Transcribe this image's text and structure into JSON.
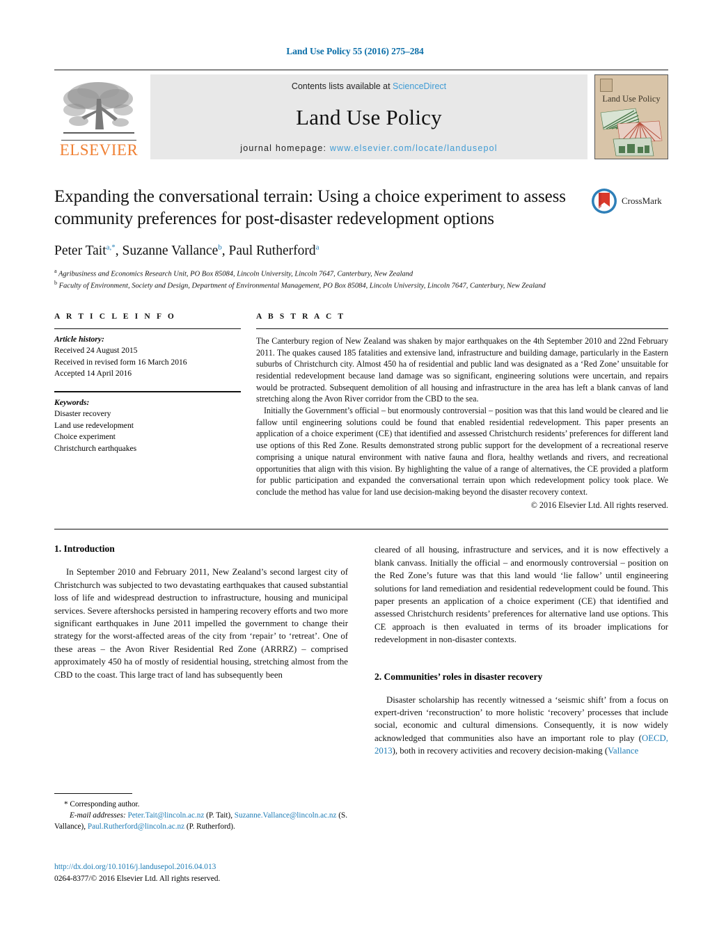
{
  "running_head": "Land Use Policy 55 (2016) 275–284",
  "masthead": {
    "contents_prefix": "Contents lists available at ",
    "sciencedirect": "ScienceDirect",
    "journal_name": "Land Use Policy",
    "homepage_prefix": "journal homepage: ",
    "homepage_url": "www.elsevier.com/locate/landusepol",
    "publisher": "ELSEVIER",
    "cover_title": "Land Use Policy",
    "logo_icon": "elsevier-tree-icon",
    "accent_orange": "#f08033",
    "link_blue": "#3f9bd4"
  },
  "article": {
    "title": "Expanding the conversational terrain: Using a choice experiment to assess community preferences for post-disaster redevelopment options",
    "crossmark_label": "CrossMark",
    "authors_html": "Peter Tait<sup>a,</sup><sup>*</sup>, Suzanne Vallance<sup>b</sup>, Paul Rutherford<sup>a</sup>",
    "affiliation_a": "Agribusiness and Economics Research Unit, PO Box 85084, Lincoln University, Lincoln 7647, Canterbury, New Zealand",
    "affiliation_b": "Faculty of Environment, Society and Design, Department of Environmental Management, PO Box 85084, Lincoln University, Lincoln 7647, Canterbury, New Zealand"
  },
  "article_info": {
    "heading": "A R T I C L E   I N F O",
    "history_label": "Article history:",
    "history": [
      "Received 24 August 2015",
      "Received in revised form 16 March 2016",
      "Accepted 14 April 2016"
    ],
    "keywords_label": "Keywords:",
    "keywords": [
      "Disaster recovery",
      "Land use redevelopment",
      "Choice experiment",
      "Christchurch earthquakes"
    ]
  },
  "abstract": {
    "heading": "A B S T R A C T",
    "paragraph_1": "The Canterbury region of New Zealand was shaken by major earthquakes on the 4th September 2010 and 22nd February 2011. The quakes caused 185 fatalities and extensive land, infrastructure and building damage, particularly in the Eastern suburbs of Christchurch city. Almost 450 ha of residential and public land was designated as a ‘Red Zone’ unsuitable for residential redevelopment because land damage was so significant, engineering solutions were uncertain, and repairs would be protracted. Subsequent demolition of all housing and infrastructure in the area has left a blank canvas of land stretching along the Avon River corridor from the CBD to the sea.",
    "paragraph_2": "Initially the Government’s official – but enormously controversial – position was that this land would be cleared and lie fallow until engineering solutions could be found that enabled residential redevelopment. This paper presents an application of a choice experiment (CE) that identified and assessed Christchurch residents’ preferences for different land use options of this Red Zone. Results demonstrated strong public support for the development of a recreational reserve comprising a unique natural environment with native fauna and flora, healthy wetlands and rivers, and recreational opportunities that align with this vision. By highlighting the value of a range of alternatives, the CE provided a platform for public participation and expanded the conversational terrain upon which redevelopment policy took place. We conclude the method has value for land use decision-making beyond the disaster recovery context.",
    "copyright": "© 2016 Elsevier Ltd. All rights reserved."
  },
  "body": {
    "left": {
      "section_1_heading": "1.  Introduction",
      "paragraph_1": "In September 2010 and February 2011, New Zealand’s second largest city of Christchurch was subjected to two devastating earthquakes that caused substantial loss of life and widespread destruction to infrastructure, housing and municipal services. Severe aftershocks persisted in hampering recovery efforts and two more significant earthquakes in June 2011 impelled the government to change their strategy for the worst-affected areas of the city from ‘repair’ to ‘retreat’. One of these areas – the Avon River Residential Red Zone (ARRRZ) – comprised approximately 450 ha of mostly of residential housing, stretching almost from the CBD to the coast. This large tract of land has subsequently been"
    },
    "right": {
      "paragraph_1": "cleared of all housing, infrastructure and services, and it is now effectively a blank canvass. Initially the official – and enormously controversial – position on the Red Zone’s future was that this land would ‘lie fallow’ until engineering solutions for land remediation and residential redevelopment could be found. This paper presents an application of a choice experiment (CE) that identified and assessed Christchurch residents’ preferences for alternative land use options. This CE approach is then evaluated in terms of its broader implications for redevelopment in non-disaster contexts.",
      "section_2_heading": "2.  Communities’ roles in disaster recovery",
      "paragraph_2_part1": "Disaster scholarship has recently witnessed a ‘seismic shift’ from a focus on expert-driven ‘reconstruction’ to more holistic ‘recovery’ processes that include social, economic and cultural dimensions. Consequently, it is now widely acknowledged that communities also have an important role to play (",
      "paragraph_2_ref1": "OECD, 2013",
      "paragraph_2_part2": "), both in recovery activities and recovery decision-making (",
      "paragraph_2_ref2": "Vallance"
    }
  },
  "footnotes": {
    "corresponding": "*  Corresponding author.",
    "email_label": "E-mail addresses:",
    "email_1": "Peter.Tait@lincoln.ac.nz",
    "email_1_name": "(P. Tait),",
    "email_2": "Suzanne.Vallance@lincoln.ac.nz",
    "email_2_name": "(S. Vallance),",
    "email_3": "Paul.Rutherford@lincoln.ac.nz",
    "email_3_name": "(P. Rutherford).",
    "doi": "http://dx.doi.org/10.1016/j.landusepol.2016.04.013",
    "issn_line": "0264-8377/© 2016 Elsevier Ltd. All rights reserved."
  }
}
